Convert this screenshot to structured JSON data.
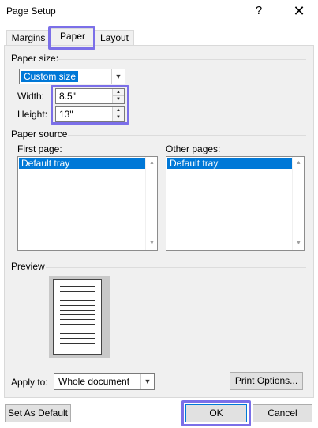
{
  "window": {
    "title": "Page Setup",
    "help_glyph": "?",
    "close_glyph": "✕"
  },
  "tabs": [
    {
      "label": "Margins",
      "active": false
    },
    {
      "label": "Paper",
      "active": true
    },
    {
      "label": "Layout",
      "active": false
    }
  ],
  "paper_size": {
    "group_label": "Paper size:",
    "selected": "Custom size",
    "width_label": "Width:",
    "width_value": "8.5\"",
    "height_label": "Height:",
    "height_value": "13\""
  },
  "paper_source": {
    "group_label": "Paper source",
    "first_page_label": "First page:",
    "first_page_items": [
      "Default tray"
    ],
    "other_pages_label": "Other pages:",
    "other_pages_items": [
      "Default tray"
    ]
  },
  "preview": {
    "label": "Preview"
  },
  "apply_to": {
    "label": "Apply to:",
    "selected": "Whole document"
  },
  "buttons": {
    "print_options": "Print Options...",
    "set_as_default": "Set As Default",
    "ok": "OK",
    "cancel": "Cancel"
  },
  "colors": {
    "selection": "#0078d7",
    "highlight_outline": "#7b6fe8",
    "panel_bg": "#f0f0f0"
  }
}
